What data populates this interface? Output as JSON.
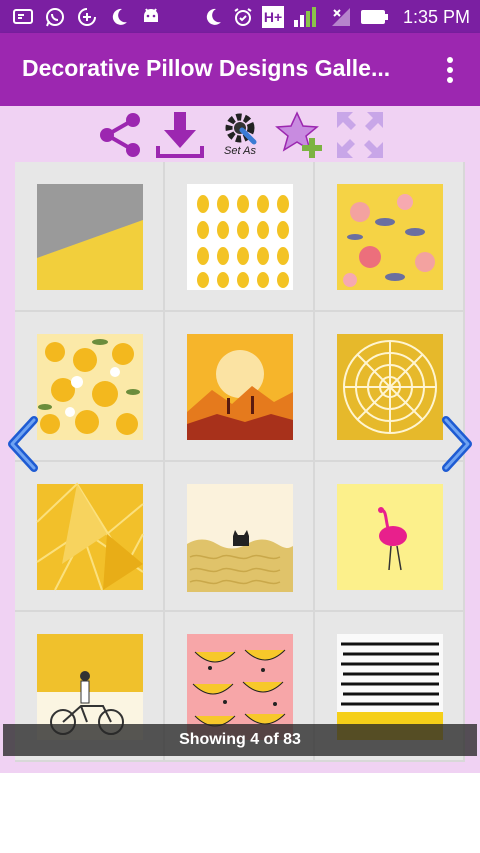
{
  "status_bar": {
    "time": "1:35 PM",
    "network_label": "H+",
    "icons": [
      "screen-cast-icon",
      "whatsapp-icon",
      "data-saver-icon",
      "moon-icon",
      "android-icon",
      "do-not-disturb-icon",
      "alarm-icon",
      "network-type-icon",
      "signal-icon",
      "no-signal-icon",
      "battery-icon"
    ]
  },
  "app_bar": {
    "title": "Decorative Pillow Designs Galle...",
    "menu_icon": "more-vert-icon"
  },
  "toolbar": {
    "share_icon": "share-icon",
    "download_icon": "download-icon",
    "set_as_label": "Set As",
    "set_as_icon": "settings-wrench-icon",
    "favorite_icon": "star-plus-icon",
    "fullscreen_icon": "fullscreen-icon"
  },
  "gallery": {
    "items": [
      "gray-yellow-diagonal-pillow",
      "pineapple-pattern-pillow",
      "floral-yellow-pillow",
      "yellow-flowers-pillow",
      "desert-sunset-pillow",
      "yellow-petal-pillow",
      "geometric-yellow-pillow",
      "black-cat-pillow",
      "flamingo-pillow",
      "bicycle-rider-pillow",
      "banana-pink-pillow",
      "black-stripes-pillow"
    ],
    "prev_icon": "chevron-left-icon",
    "next_icon": "chevron-right-icon",
    "caption": "Showing 4 of 83"
  },
  "colors": {
    "status_bar": "#7b1fa2",
    "app_bar": "#9c27b0",
    "background": "#f0d2f3",
    "pillow_yellow": "#f2c31f",
    "nav_blue": "#1e5bd3"
  }
}
